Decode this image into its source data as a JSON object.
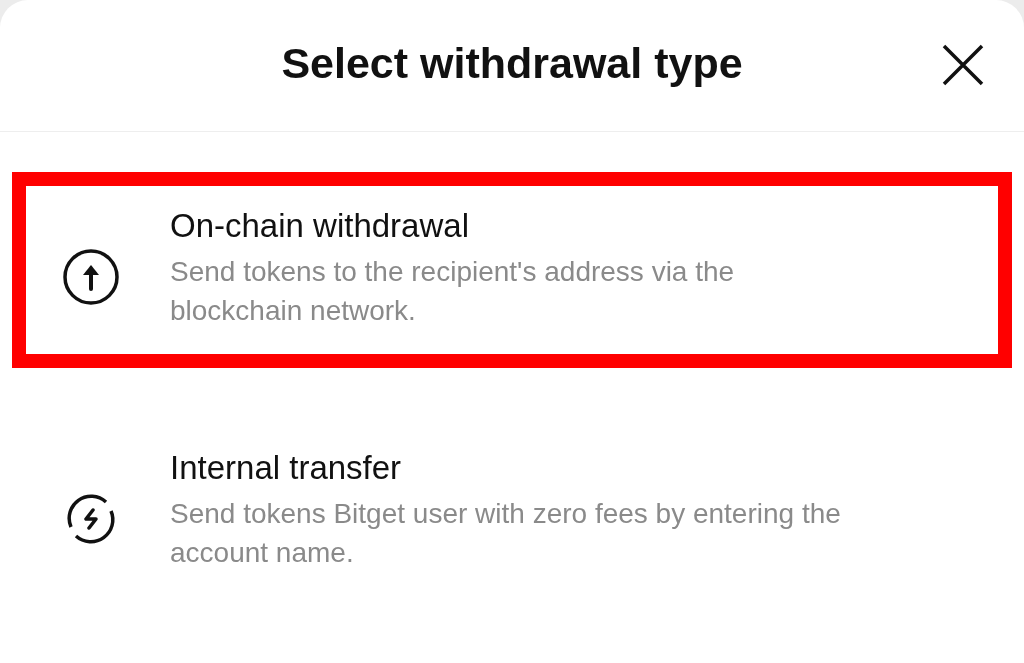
{
  "sheet": {
    "title": "Select withdrawal type"
  },
  "options": [
    {
      "kind": "upload",
      "title": "On-chain withdrawal",
      "description": "Send tokens to the recipient's address via the blockchain network.",
      "highlighted": true
    },
    {
      "kind": "transfer",
      "title": "Internal transfer",
      "description": "Send tokens Bitget user with zero fees by entering the account name.",
      "highlighted": false
    }
  ]
}
